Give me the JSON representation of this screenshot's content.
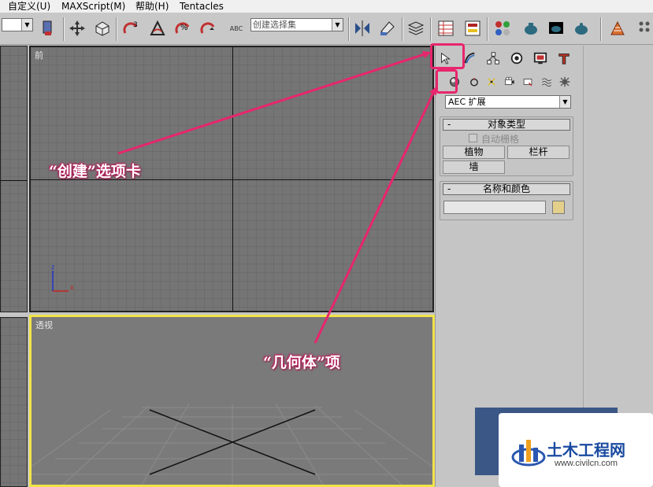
{
  "menu": {
    "items": [
      "自定义(U)",
      "MAXScript(M)",
      "帮助(H)",
      "Tentacles"
    ]
  },
  "toolbar": {
    "selection_set_placeholder": "创建选择集",
    "abc_label": "ABC"
  },
  "viewports": {
    "front_label": "前",
    "perspective_label": "透视",
    "axis_z": "z",
    "axis_x": "x"
  },
  "command_panel": {
    "category_value": "AEC 扩展",
    "object_type": {
      "header": "对象类型",
      "autogrid_label": "自动栅格",
      "buttons": [
        "植物",
        "栏杆",
        "墙"
      ]
    },
    "name_color": {
      "header": "名称和颜色",
      "name_value": "",
      "color": "#e4cf8b"
    },
    "collapse_symbol": "-"
  },
  "annotations": {
    "create_tab": "“创建”选项卡",
    "geometry_item": "“几何体”项"
  },
  "watermark": {
    "title": "土木工程网",
    "url": "www.civilcn.com"
  },
  "colors": {
    "highlight": "#e8256d",
    "active_viewport_border": "#f2e34a"
  }
}
